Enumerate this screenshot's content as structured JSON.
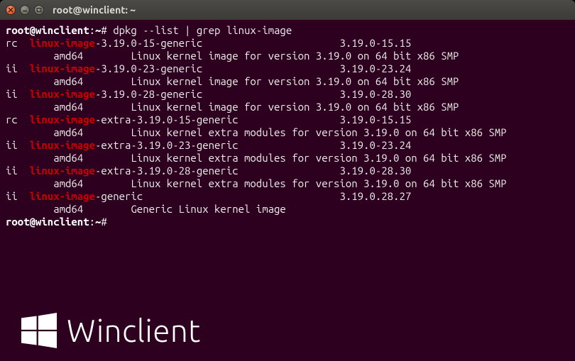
{
  "window": {
    "title": "root@winclient: ~"
  },
  "prompt": {
    "userhost": "root@winclient",
    "path": "~",
    "symbol": "#"
  },
  "command": "dpkg --list | grep linux-image",
  "packages": [
    {
      "status": "rc",
      "name_hl": "linux-image",
      "name_rest": "-3.19.0-15-generic",
      "version": "3.19.0-15.15",
      "arch": "amd64",
      "desc": "Linux kernel image for version 3.19.0 on 64 bit x86 SMP"
    },
    {
      "status": "ii",
      "name_hl": "linux-image",
      "name_rest": "-3.19.0-23-generic",
      "version": "3.19.0-23.24",
      "arch": "amd64",
      "desc": "Linux kernel image for version 3.19.0 on 64 bit x86 SMP"
    },
    {
      "status": "ii",
      "name_hl": "linux-image",
      "name_rest": "-3.19.0-28-generic",
      "version": "3.19.0-28.30",
      "arch": "amd64",
      "desc": "Linux kernel image for version 3.19.0 on 64 bit x86 SMP"
    },
    {
      "status": "rc",
      "name_hl": "linux-image",
      "name_rest": "-extra-3.19.0-15-generic",
      "version": "3.19.0-15.15",
      "arch": "amd64",
      "desc": "Linux kernel extra modules for version 3.19.0 on 64 bit x86 SMP"
    },
    {
      "status": "ii",
      "name_hl": "linux-image",
      "name_rest": "-extra-3.19.0-23-generic",
      "version": "3.19.0-23.24",
      "arch": "amd64",
      "desc": "Linux kernel extra modules for version 3.19.0 on 64 bit x86 SMP"
    },
    {
      "status": "ii",
      "name_hl": "linux-image",
      "name_rest": "-extra-3.19.0-28-generic",
      "version": "3.19.0-28.30",
      "arch": "amd64",
      "desc": "Linux kernel extra modules for version 3.19.0 on 64 bit x86 SMP"
    },
    {
      "status": "ii",
      "name_hl": "linux-image",
      "name_rest": "-generic",
      "version": "3.19.0.28.27",
      "arch": "amd64",
      "desc": "Generic Linux kernel image"
    }
  ],
  "watermark": {
    "text": "Winclient"
  }
}
